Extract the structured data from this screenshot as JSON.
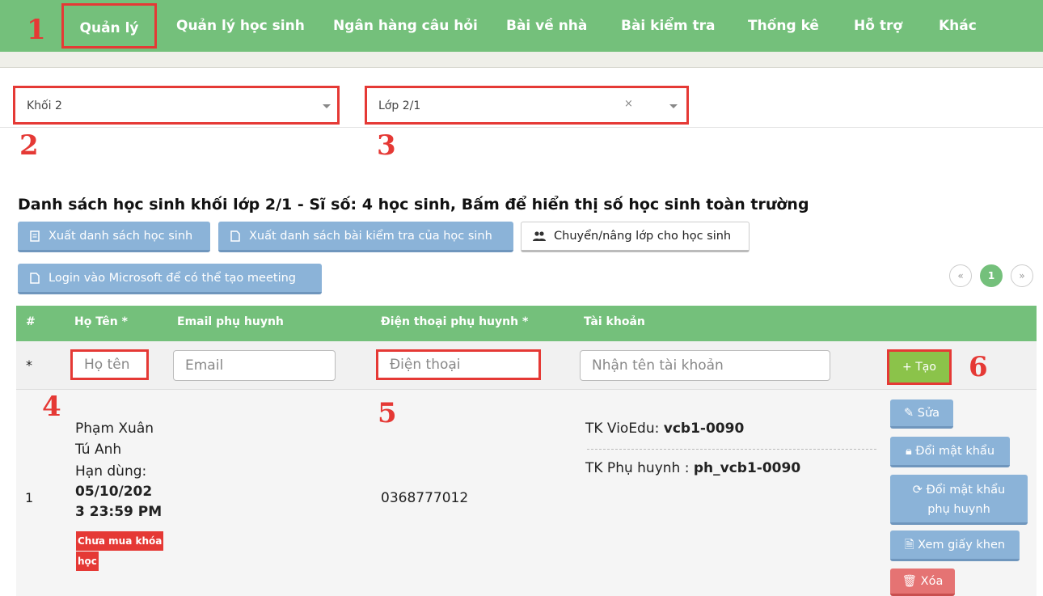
{
  "nav": {
    "items": [
      "Quản lý",
      "Quản lý học sinh",
      "Ngân hàng câu hỏi",
      "Bài về nhà",
      "Bài kiểm tra",
      "Thống kê",
      "Hỗ trợ",
      "Khác"
    ],
    "active_index": 0
  },
  "markers": [
    "1",
    "2",
    "3",
    "4",
    "5",
    "6"
  ],
  "filters": {
    "grade": "Khối 2",
    "class": "Lớp 2/1",
    "clear_symbol": "×"
  },
  "title": "Danh sách học sinh khối lớp 2/1 - Sĩ số: 4 học sinh, Bấm để hiển thị số học sinh toàn trường",
  "buttons": {
    "export_students": "Xuất danh sách học sinh",
    "export_tests": "Xuất danh sách bài kiểm tra của học sinh",
    "move_class": "Chuyển/nâng lớp cho học sinh",
    "login_ms": "Login vào Microsoft để có thể tạo meeting"
  },
  "pager": {
    "prev": "«",
    "current": "1",
    "next": "»"
  },
  "table": {
    "headers": [
      "#",
      "Họ Tên *",
      "Email phụ huynh",
      "Điện thoại phụ huynh *",
      "Tài khoản"
    ],
    "input_row": {
      "marker": "*",
      "name_placeholder": "Họ tên",
      "email_placeholder": "Email",
      "phone_placeholder": "Điện thoại",
      "account_placeholder": "Nhận tên tài khoản",
      "create_label": "+ Tạo"
    },
    "rows": [
      {
        "index": "1",
        "name_line1": "Phạm Xuân",
        "name_line2": "Tú Anh",
        "expiry_label": "Hạn dùng:",
        "expiry_line1": "05/10/202",
        "expiry_line2": "3 23:59 PM",
        "badge_line1": "Chưa mua khóa",
        "badge_line2": "học",
        "phone": "0368777012",
        "acc_label": "TK VioEdu:",
        "acc_value": "vcb1-0090",
        "parent_label": "TK Phụ huynh :",
        "parent_value": "ph_vcb1-0090",
        "actions": {
          "edit": "Sửa",
          "change_pw": "Đổi mật khẩu",
          "change_parent_pw_1": "Đổi mật khẩu",
          "change_parent_pw_2": "phụ huynh",
          "certificate": "Xem giấy khen",
          "delete": "Xóa"
        }
      }
    ]
  }
}
